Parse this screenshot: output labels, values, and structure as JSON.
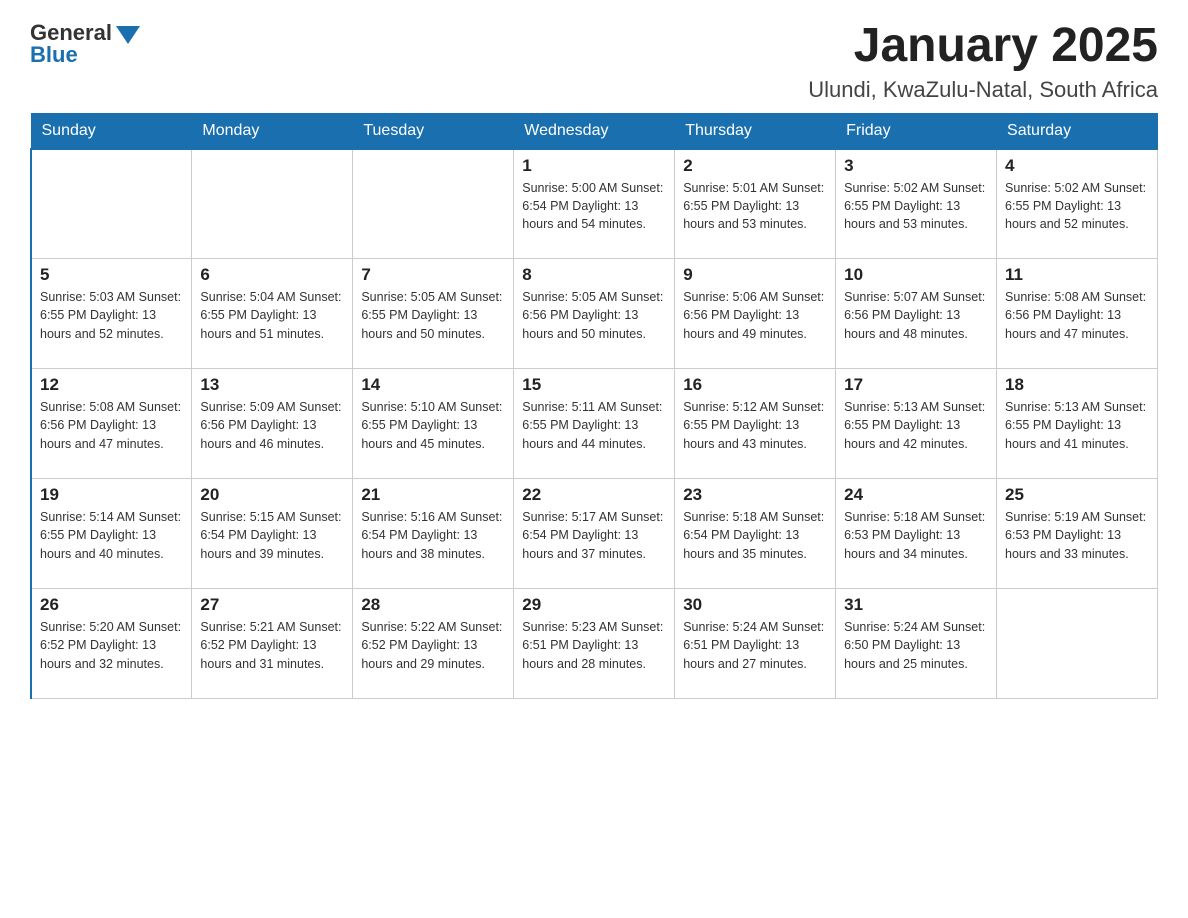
{
  "logo": {
    "general": "General",
    "blue": "Blue"
  },
  "header": {
    "month": "January 2025",
    "location": "Ulundi, KwaZulu-Natal, South Africa"
  },
  "weekdays": [
    "Sunday",
    "Monday",
    "Tuesday",
    "Wednesday",
    "Thursday",
    "Friday",
    "Saturday"
  ],
  "weeks": [
    [
      {
        "day": "",
        "info": ""
      },
      {
        "day": "",
        "info": ""
      },
      {
        "day": "",
        "info": ""
      },
      {
        "day": "1",
        "info": "Sunrise: 5:00 AM\nSunset: 6:54 PM\nDaylight: 13 hours\nand 54 minutes."
      },
      {
        "day": "2",
        "info": "Sunrise: 5:01 AM\nSunset: 6:55 PM\nDaylight: 13 hours\nand 53 minutes."
      },
      {
        "day": "3",
        "info": "Sunrise: 5:02 AM\nSunset: 6:55 PM\nDaylight: 13 hours\nand 53 minutes."
      },
      {
        "day": "4",
        "info": "Sunrise: 5:02 AM\nSunset: 6:55 PM\nDaylight: 13 hours\nand 52 minutes."
      }
    ],
    [
      {
        "day": "5",
        "info": "Sunrise: 5:03 AM\nSunset: 6:55 PM\nDaylight: 13 hours\nand 52 minutes."
      },
      {
        "day": "6",
        "info": "Sunrise: 5:04 AM\nSunset: 6:55 PM\nDaylight: 13 hours\nand 51 minutes."
      },
      {
        "day": "7",
        "info": "Sunrise: 5:05 AM\nSunset: 6:55 PM\nDaylight: 13 hours\nand 50 minutes."
      },
      {
        "day": "8",
        "info": "Sunrise: 5:05 AM\nSunset: 6:56 PM\nDaylight: 13 hours\nand 50 minutes."
      },
      {
        "day": "9",
        "info": "Sunrise: 5:06 AM\nSunset: 6:56 PM\nDaylight: 13 hours\nand 49 minutes."
      },
      {
        "day": "10",
        "info": "Sunrise: 5:07 AM\nSunset: 6:56 PM\nDaylight: 13 hours\nand 48 minutes."
      },
      {
        "day": "11",
        "info": "Sunrise: 5:08 AM\nSunset: 6:56 PM\nDaylight: 13 hours\nand 47 minutes."
      }
    ],
    [
      {
        "day": "12",
        "info": "Sunrise: 5:08 AM\nSunset: 6:56 PM\nDaylight: 13 hours\nand 47 minutes."
      },
      {
        "day": "13",
        "info": "Sunrise: 5:09 AM\nSunset: 6:56 PM\nDaylight: 13 hours\nand 46 minutes."
      },
      {
        "day": "14",
        "info": "Sunrise: 5:10 AM\nSunset: 6:55 PM\nDaylight: 13 hours\nand 45 minutes."
      },
      {
        "day": "15",
        "info": "Sunrise: 5:11 AM\nSunset: 6:55 PM\nDaylight: 13 hours\nand 44 minutes."
      },
      {
        "day": "16",
        "info": "Sunrise: 5:12 AM\nSunset: 6:55 PM\nDaylight: 13 hours\nand 43 minutes."
      },
      {
        "day": "17",
        "info": "Sunrise: 5:13 AM\nSunset: 6:55 PM\nDaylight: 13 hours\nand 42 minutes."
      },
      {
        "day": "18",
        "info": "Sunrise: 5:13 AM\nSunset: 6:55 PM\nDaylight: 13 hours\nand 41 minutes."
      }
    ],
    [
      {
        "day": "19",
        "info": "Sunrise: 5:14 AM\nSunset: 6:55 PM\nDaylight: 13 hours\nand 40 minutes."
      },
      {
        "day": "20",
        "info": "Sunrise: 5:15 AM\nSunset: 6:54 PM\nDaylight: 13 hours\nand 39 minutes."
      },
      {
        "day": "21",
        "info": "Sunrise: 5:16 AM\nSunset: 6:54 PM\nDaylight: 13 hours\nand 38 minutes."
      },
      {
        "day": "22",
        "info": "Sunrise: 5:17 AM\nSunset: 6:54 PM\nDaylight: 13 hours\nand 37 minutes."
      },
      {
        "day": "23",
        "info": "Sunrise: 5:18 AM\nSunset: 6:54 PM\nDaylight: 13 hours\nand 35 minutes."
      },
      {
        "day": "24",
        "info": "Sunrise: 5:18 AM\nSunset: 6:53 PM\nDaylight: 13 hours\nand 34 minutes."
      },
      {
        "day": "25",
        "info": "Sunrise: 5:19 AM\nSunset: 6:53 PM\nDaylight: 13 hours\nand 33 minutes."
      }
    ],
    [
      {
        "day": "26",
        "info": "Sunrise: 5:20 AM\nSunset: 6:52 PM\nDaylight: 13 hours\nand 32 minutes."
      },
      {
        "day": "27",
        "info": "Sunrise: 5:21 AM\nSunset: 6:52 PM\nDaylight: 13 hours\nand 31 minutes."
      },
      {
        "day": "28",
        "info": "Sunrise: 5:22 AM\nSunset: 6:52 PM\nDaylight: 13 hours\nand 29 minutes."
      },
      {
        "day": "29",
        "info": "Sunrise: 5:23 AM\nSunset: 6:51 PM\nDaylight: 13 hours\nand 28 minutes."
      },
      {
        "day": "30",
        "info": "Sunrise: 5:24 AM\nSunset: 6:51 PM\nDaylight: 13 hours\nand 27 minutes."
      },
      {
        "day": "31",
        "info": "Sunrise: 5:24 AM\nSunset: 6:50 PM\nDaylight: 13 hours\nand 25 minutes."
      },
      {
        "day": "",
        "info": ""
      }
    ]
  ]
}
